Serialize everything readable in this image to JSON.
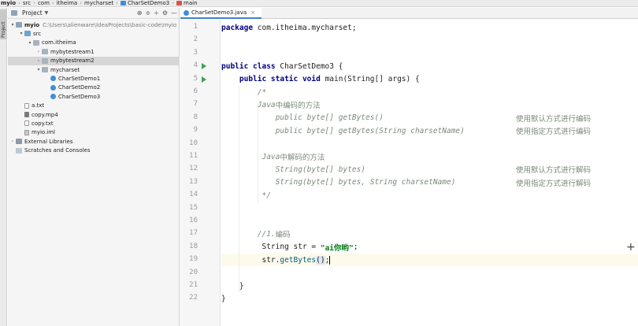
{
  "breadcrumb": [
    {
      "label": "myio",
      "bold": true
    },
    {
      "label": "src"
    },
    {
      "label": "com"
    },
    {
      "label": "itheima"
    },
    {
      "label": "mycharset"
    },
    {
      "label": "CharSetDemo3"
    },
    {
      "label": "main"
    }
  ],
  "project_panel": {
    "side_tab": "Project",
    "title": "Project",
    "tree": [
      {
        "label": "myio",
        "path": "C:\\Users\\alienware\\IdeaProjects\\basic-code\\myio",
        "level": 0,
        "arrow": "▾",
        "icon": "folder-icon"
      },
      {
        "label": "src",
        "level": 1,
        "arrow": "▾",
        "icon": "source-folder-icon"
      },
      {
        "label": "com.itheima",
        "level": 2,
        "arrow": "▾",
        "icon": "package-icon"
      },
      {
        "label": "mybytestream1",
        "level": 3,
        "arrow": "›",
        "icon": "package-icon"
      },
      {
        "label": "mybytestream2",
        "level": 3,
        "arrow": "›",
        "icon": "package-icon",
        "selected": true
      },
      {
        "label": "mycharset",
        "level": 3,
        "arrow": "▾",
        "icon": "package-icon"
      },
      {
        "label": "CharSetDemo1",
        "level": 4,
        "arrow": "",
        "icon": "class-icon"
      },
      {
        "label": "CharSetDemo2",
        "level": 4,
        "arrow": "",
        "icon": "class-icon"
      },
      {
        "label": "CharSetDemo3",
        "level": 4,
        "arrow": "",
        "icon": "class-icon"
      },
      {
        "label": "a.txt",
        "level": 1,
        "arrow": "",
        "icon": "text-file-icon"
      },
      {
        "label": "copy.mp4",
        "level": 1,
        "arrow": "",
        "icon": "video-file-icon"
      },
      {
        "label": "copy.txt",
        "level": 1,
        "arrow": "",
        "icon": "text-file-icon"
      },
      {
        "label": "myio.iml",
        "level": 1,
        "arrow": "",
        "icon": "module-file-icon"
      },
      {
        "label": "External Libraries",
        "level": 0,
        "arrow": "›",
        "icon": "library-icon"
      },
      {
        "label": "Scratches and Consoles",
        "level": 0,
        "arrow": "",
        "icon": "scratch-icon"
      }
    ]
  },
  "editor": {
    "tab_label": "CharSetDemo3.java",
    "lines": [
      {
        "n": "1",
        "code": [
          {
            "t": "kw",
            "s": "package"
          },
          {
            "t": "",
            "s": " com.itheima.mycharset;"
          }
        ]
      },
      {
        "n": "2",
        "code": []
      },
      {
        "n": "3",
        "code": []
      },
      {
        "n": "4",
        "run": true,
        "code": [
          {
            "t": "kw",
            "s": "public class"
          },
          {
            "t": "",
            "s": " CharSetDemo3 {"
          }
        ]
      },
      {
        "n": "5",
        "run": true,
        "code": [
          {
            "t": "",
            "s": "    "
          },
          {
            "t": "kw",
            "s": "public static void"
          },
          {
            "t": "",
            "s": " main(String[] args) {"
          }
        ]
      },
      {
        "n": "6",
        "code": [
          {
            "t": "cm",
            "s": "        /*"
          }
        ]
      },
      {
        "n": "7",
        "code": [
          {
            "t": "cm",
            "s": "        Java"
          },
          {
            "t": "cmzh",
            "s": "中编码的方法"
          }
        ]
      },
      {
        "n": "8",
        "code": [
          {
            "t": "cm",
            "s": "            public byte[] getBytes()"
          }
        ],
        "right": "使用默认方式进行编码"
      },
      {
        "n": "9",
        "code": [
          {
            "t": "cm",
            "s": "            public byte[] getBytes(String charsetName)"
          }
        ],
        "right": "使用指定方式进行编码"
      },
      {
        "n": "10",
        "code": []
      },
      {
        "n": "11",
        "code": [
          {
            "t": "cm",
            "s": "         Java"
          },
          {
            "t": "cmzh",
            "s": "中解码的方法"
          }
        ]
      },
      {
        "n": "12",
        "code": [
          {
            "t": "cm",
            "s": "            String(byte[] bytes)"
          }
        ],
        "right": "使用默认方式进行解码"
      },
      {
        "n": "13",
        "code": [
          {
            "t": "cm",
            "s": "            String(byte[] bytes, String charsetName)"
          }
        ],
        "right": "使用指定方式进行解码"
      },
      {
        "n": "14",
        "code": [
          {
            "t": "cm",
            "s": "         */"
          }
        ]
      },
      {
        "n": "15",
        "code": []
      },
      {
        "n": "16",
        "code": []
      },
      {
        "n": "17",
        "code": [
          {
            "t": "cm",
            "s": "        //1."
          },
          {
            "t": "cmzh",
            "s": "编码"
          }
        ]
      },
      {
        "n": "18",
        "code": [
          {
            "t": "",
            "s": "         String str = "
          },
          {
            "t": "str",
            "s": "\"ai你哟\""
          },
          {
            "t": "",
            "s": ";"
          }
        ]
      },
      {
        "n": "19",
        "cur": true,
        "code": [
          {
            "t": "",
            "s": "         str."
          },
          {
            "t": "call",
            "s": "getBytes"
          },
          {
            "t": "hl",
            "s": "()"
          },
          {
            "t": "",
            "s": ";"
          },
          {
            "t": "caret",
            "s": ""
          }
        ]
      },
      {
        "n": "20",
        "code": []
      },
      {
        "n": "21",
        "code": [
          {
            "t": "",
            "s": "    }"
          }
        ]
      },
      {
        "n": "22",
        "code": [
          {
            "t": "",
            "s": "}"
          }
        ]
      }
    ]
  },
  "colors": {
    "accent": "#4083c9",
    "run": "#3ba34a",
    "keyword": "#000080",
    "string": "#067d17"
  }
}
